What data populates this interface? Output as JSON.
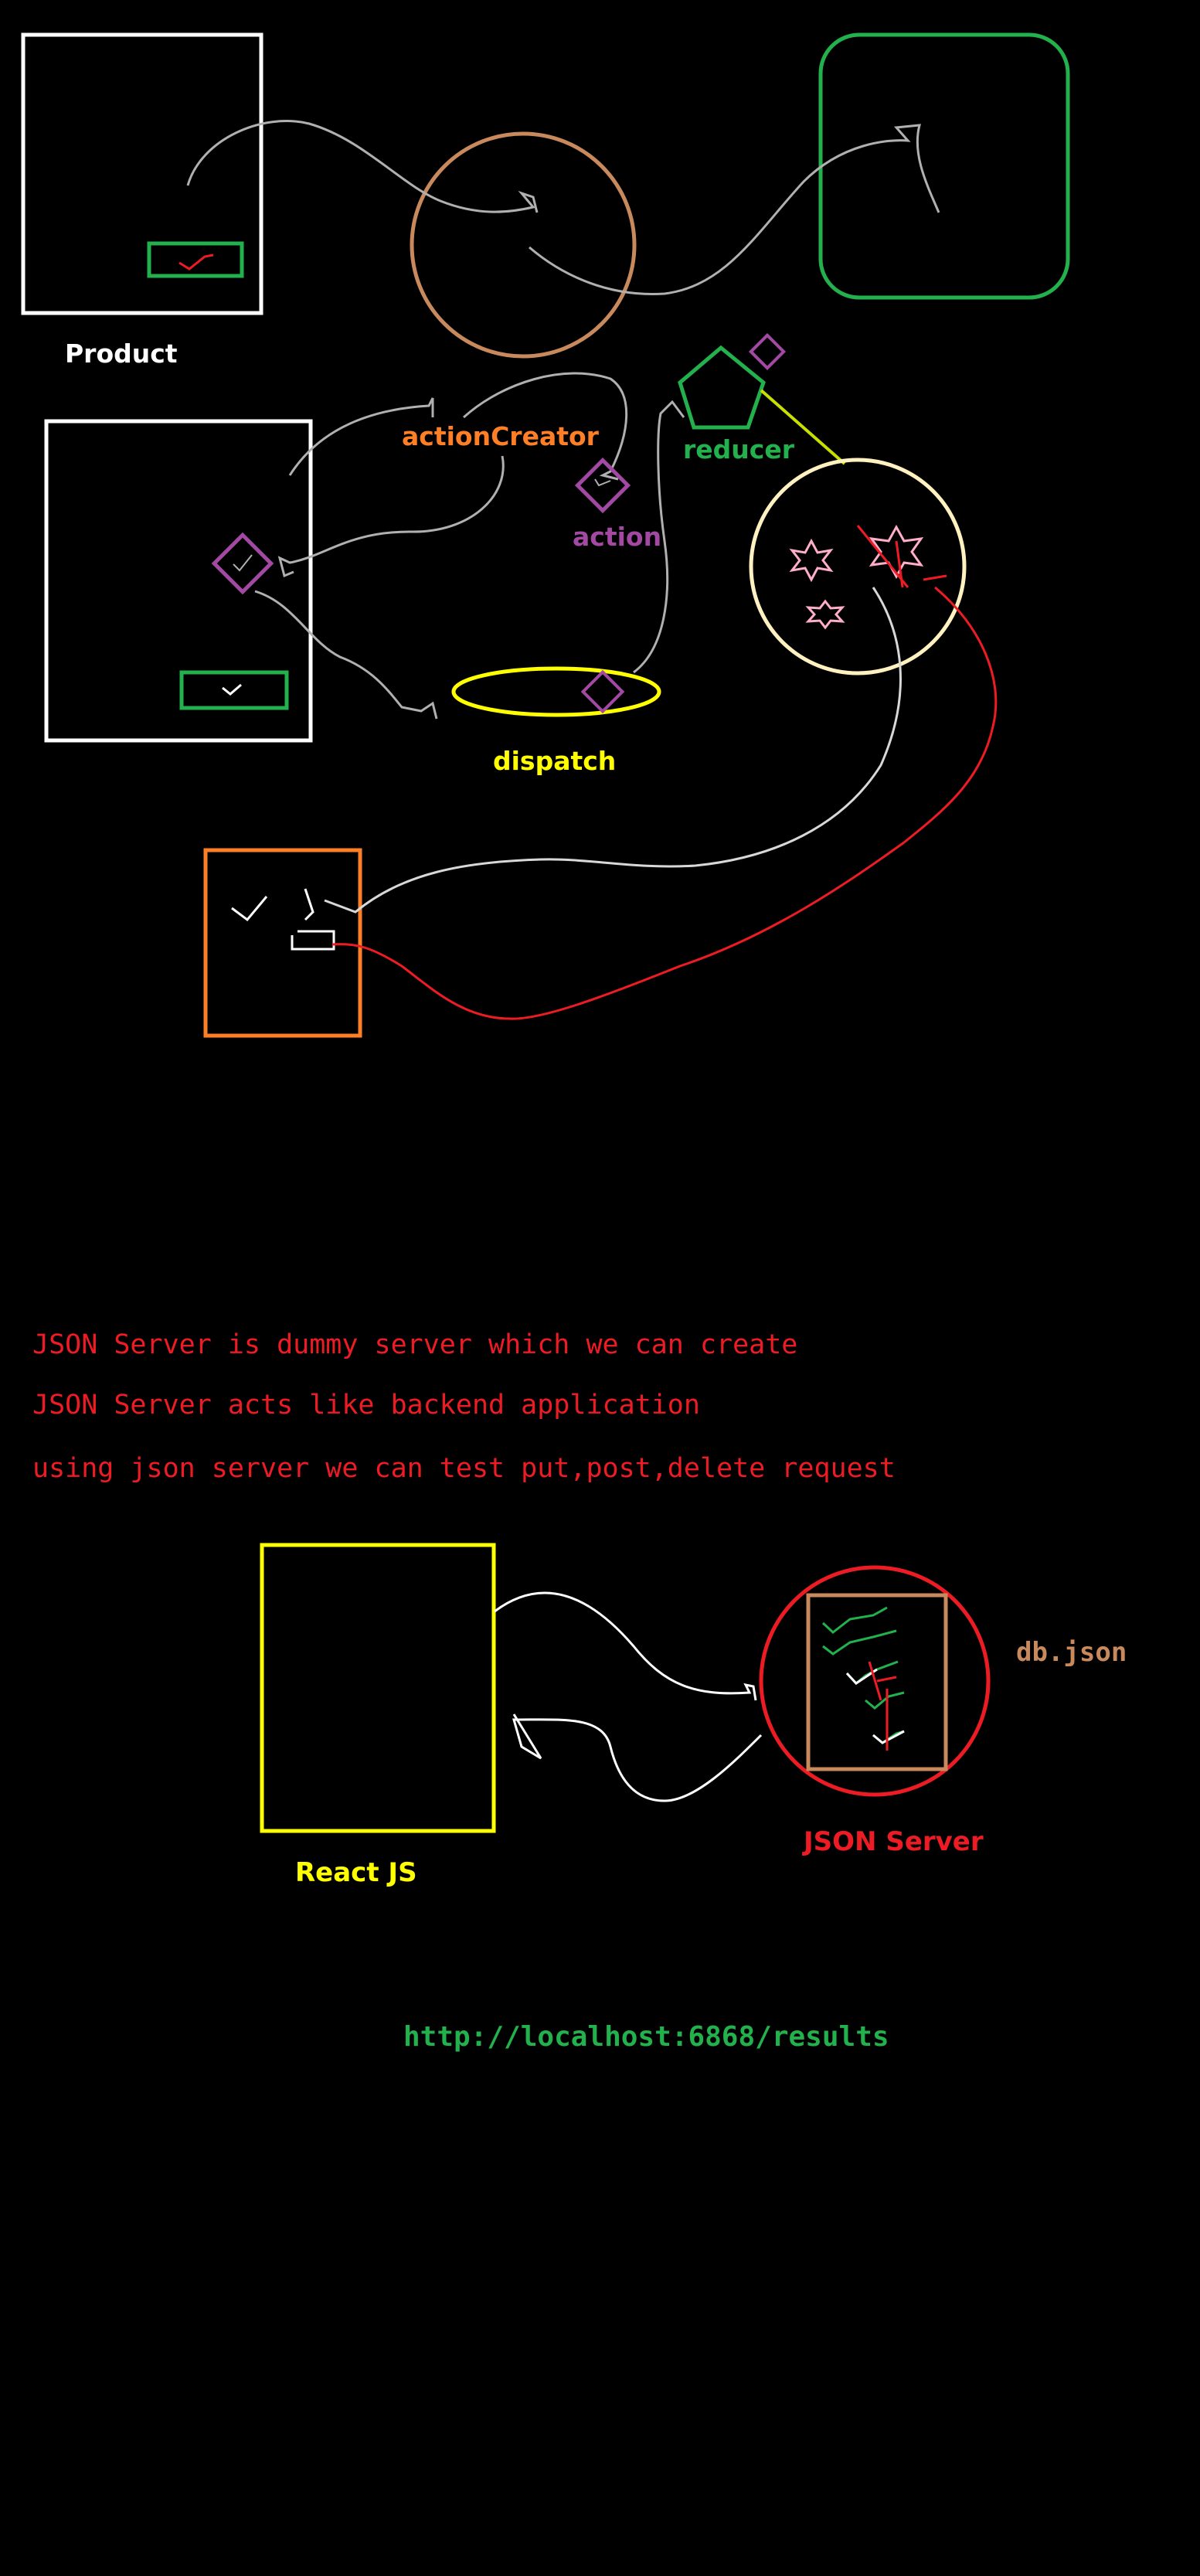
{
  "labels": {
    "product": "Product",
    "action_creator": "actionCreator",
    "action": "action",
    "reducer": "reducer",
    "dispatch": "dispatch",
    "react_js": "React JS",
    "json_server": "JSON Server",
    "db_json": "db.json"
  },
  "notes": [
    "JSON Server is dummy server which we can create",
    "JSON Server acts like backend application",
    "using json server we can test put,post,delete request"
  ],
  "url": "http://localhost:6868/results",
  "colors": {
    "background": "#000000",
    "white": "#ffffff",
    "green": "#22b14c",
    "orange": "#ff7f27",
    "purple": "#a349a4",
    "yellow": "#ffff00",
    "red": "#ed1c24",
    "tan": "#c8895c",
    "cream": "#fff2c0",
    "pink": "#ffaec9",
    "gray": "#b0b0b0"
  }
}
